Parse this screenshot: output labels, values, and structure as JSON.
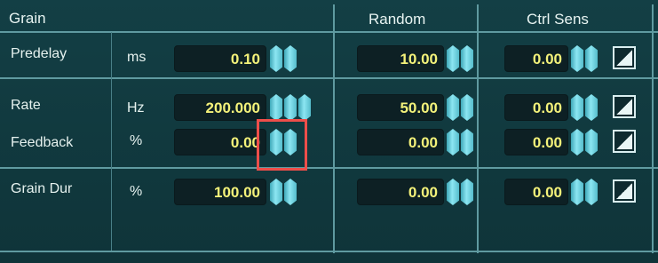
{
  "header": {
    "section": "Grain",
    "random": "Random",
    "ctrl_sens": "Ctrl Sens"
  },
  "rows": [
    {
      "label": "Predelay",
      "unit": "ms",
      "value": "0.10",
      "random": "10.00",
      "ctrl": "0.00"
    },
    {
      "label": "Rate",
      "unit": "Hz",
      "value": "200.000",
      "random": "50.00",
      "ctrl": "0.00"
    },
    {
      "label": "Feedback",
      "unit": "%",
      "value": "0.00",
      "random": "0.00",
      "ctrl": "0.00"
    },
    {
      "label": "Grain Dur",
      "unit": "%",
      "value": "100.00",
      "random": "0.00",
      "ctrl": "0.00"
    }
  ],
  "icons": {
    "spinner": "hexagon-spinner-icon",
    "ctrl": "ctrl-toggle-icon"
  },
  "colors": {
    "background": "#133f45",
    "value_text": "#f4f27a",
    "spinner": "#8ce6f2",
    "highlight": "#ee4e4a",
    "grid_line": "#5f9aa0"
  }
}
